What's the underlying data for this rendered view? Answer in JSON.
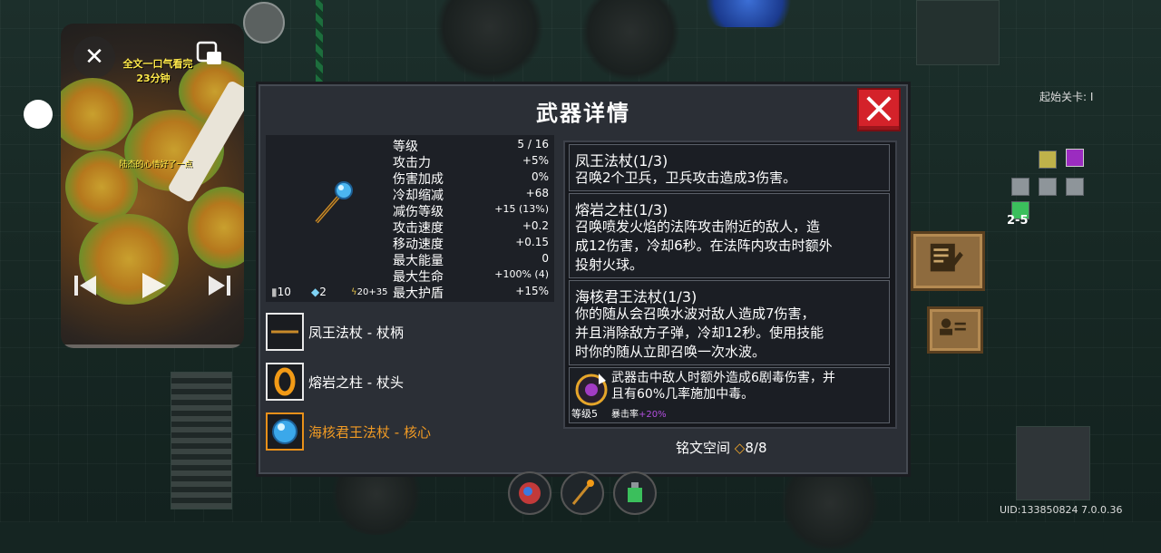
{
  "video": {
    "title_line1": "全文一口气看完",
    "title_line2": "23分钟",
    "subtitle": "陆杰的心情好了一点"
  },
  "dialog": {
    "title": "武器详情",
    "stats": [
      {
        "label": "等级",
        "value": "5 / 16"
      },
      {
        "label": "攻击力",
        "value": "+5%"
      },
      {
        "label": "伤害加成",
        "value": "0%"
      },
      {
        "label": "冷却缩减",
        "value": "+68"
      },
      {
        "label": "减伤等级",
        "value": "+15 (13%)"
      },
      {
        "label": "攻击速度",
        "value": "+0.2"
      },
      {
        "label": "移动速度",
        "value": "+0.15"
      },
      {
        "label": "最大能量",
        "value": "0"
      },
      {
        "label": "最大生命",
        "value": "+100% (4)"
      },
      {
        "label": "最大护盾",
        "value": "+15%"
      }
    ],
    "mini_stats": {
      "damage": "10",
      "energy": "2",
      "crit": "20+35"
    },
    "parts": [
      {
        "label": "凤王法杖 - 杖柄"
      },
      {
        "label": "熔岩之柱 - 杖头"
      },
      {
        "label": "海核君王法杖 - 核心"
      }
    ],
    "entries": [
      {
        "title": "凤王法杖(1/3)",
        "text": [
          "召唤2个卫兵，卫兵攻击造成3伤害。"
        ]
      },
      {
        "title": "熔岩之柱(1/3)",
        "text": [
          "召唤喷发火焰的法阵攻击附近的敌人，造",
          "成12伤害，冷却6秒。在法阵内攻击时额外",
          "投射火球。"
        ]
      },
      {
        "title": "海核君王法杖(1/3)",
        "text": [
          "你的随从会召唤水波对敌人造成7伤害，",
          "并且消除敌方子弹，冷却12秒。使用技能",
          "时你的随从立即召唤一次水波。"
        ]
      }
    ],
    "rune": {
      "text": [
        "武器击中敌人时额外造成6剧毒伤害，并",
        "且有60%几率施加中毒。"
      ],
      "level": "等级5",
      "crit_label": "暴击率",
      "crit_value": "+20%"
    },
    "rune_space_label": "铭文空间",
    "rune_space_value": "8/8"
  },
  "hud": {
    "start_level": "起始关卡: I",
    "minimap_label": "2-5",
    "uid": "UID:133850824 7.0.0.36"
  }
}
